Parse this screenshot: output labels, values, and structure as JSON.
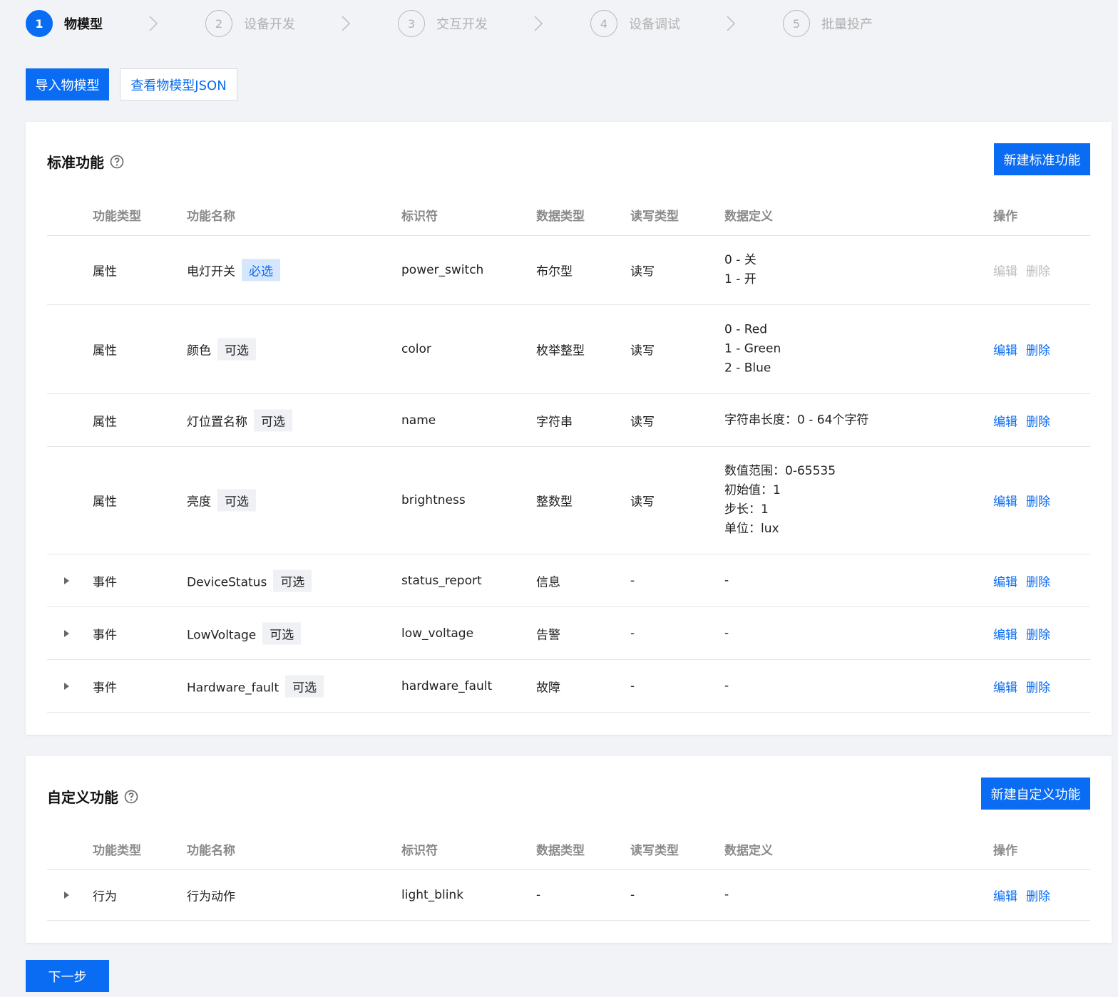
{
  "steps": [
    {
      "num": "1",
      "label": "物模型",
      "active": true
    },
    {
      "num": "2",
      "label": "设备开发",
      "active": false
    },
    {
      "num": "3",
      "label": "交互开发",
      "active": false
    },
    {
      "num": "4",
      "label": "设备调试",
      "active": false
    },
    {
      "num": "5",
      "label": "批量投产",
      "active": false
    }
  ],
  "toolbar": {
    "import_label": "导入物模型",
    "view_json_label": "查看物模型JSON"
  },
  "standard": {
    "title": "标准功能",
    "new_label": "新建标准功能",
    "columns": [
      "功能类型",
      "功能名称",
      "标识符",
      "数据类型",
      "读写类型",
      "数据定义",
      "操作"
    ],
    "rows": [
      {
        "type": "属性",
        "name": "电灯开关",
        "tag": "必选",
        "id": "power_switch",
        "dtype": "布尔型",
        "rw": "读写",
        "defs": [
          "0 - 关",
          "1 - 开"
        ],
        "edit": "编辑",
        "del": "删除"
      },
      {
        "type": "属性",
        "name": "颜色",
        "tag": "可选",
        "id": "color",
        "dtype": "枚举整型",
        "rw": "读写",
        "defs": [
          "0 - Red",
          "1 - Green",
          "2 - Blue"
        ],
        "edit": "编辑",
        "del": "删除"
      },
      {
        "type": "属性",
        "name": "灯位置名称",
        "tag": "可选",
        "id": "name",
        "dtype": "字符串",
        "rw": "读写",
        "defs": [
          "字符串长度：0 - 64个字符"
        ],
        "edit": "编辑",
        "del": "删除"
      },
      {
        "type": "属性",
        "name": "亮度",
        "tag": "可选",
        "id": "brightness",
        "dtype": "整数型",
        "rw": "读写",
        "defs": [
          "数值范围：0-65535",
          "初始值：1",
          "步长：1",
          "单位：lux"
        ],
        "edit": "编辑",
        "del": "删除"
      },
      {
        "type": "事件",
        "name": "DeviceStatus",
        "tag": "可选",
        "id": "status_report",
        "dtype": "信息",
        "rw": "-",
        "defs": [
          "-"
        ],
        "edit": "编辑",
        "del": "删除"
      },
      {
        "type": "事件",
        "name": "LowVoltage",
        "tag": "可选",
        "id": "low_voltage",
        "dtype": "告警",
        "rw": "-",
        "defs": [
          "-"
        ],
        "edit": "编辑",
        "del": "删除"
      },
      {
        "type": "事件",
        "name": "Hardware_fault",
        "tag": "可选",
        "id": "hardware_fault",
        "dtype": "故障",
        "rw": "-",
        "defs": [
          "-"
        ],
        "edit": "编辑",
        "del": "删除"
      }
    ]
  },
  "custom": {
    "title": "自定义功能",
    "new_label": "新建自定义功能",
    "columns": [
      "功能类型",
      "功能名称",
      "标识符",
      "数据类型",
      "读写类型",
      "数据定义",
      "操作"
    ],
    "rows": [
      {
        "type": "行为",
        "name": "行为动作",
        "id": "light_blink",
        "dtype": "-",
        "rw": "-",
        "defs": [
          "-"
        ],
        "edit": "编辑",
        "del": "删除"
      }
    ]
  },
  "next_label": "下一步",
  "colors": {
    "primary": "#0a6cf2",
    "disabled": "#bdbdbd",
    "page_bg": "#f2f3f7"
  }
}
